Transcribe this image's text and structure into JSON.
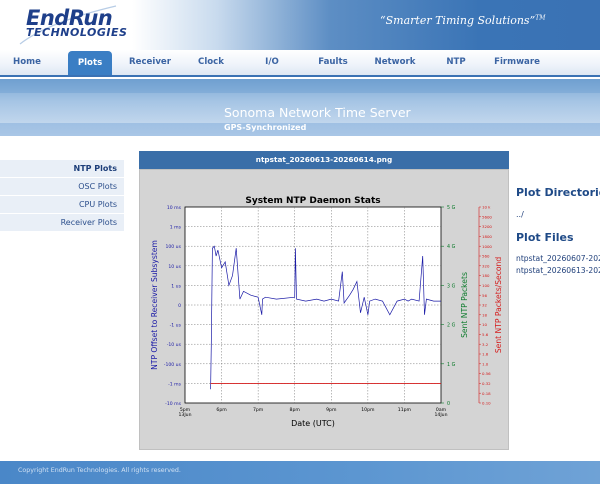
{
  "header": {
    "logo_line1": "EndRun",
    "logo_line2": "TECHNOLOGIES",
    "tagline": "“Smarter Timing Solutions”",
    "tagline_tm": "TM"
  },
  "nav": {
    "items": [
      {
        "label": "Home"
      },
      {
        "label": "Plots"
      },
      {
        "label": "Receiver"
      },
      {
        "label": "Clock"
      },
      {
        "label": "I/O"
      },
      {
        "label": "Faults"
      },
      {
        "label": "Network"
      },
      {
        "label": "NTP"
      },
      {
        "label": "Firmware"
      }
    ],
    "active": "Plots"
  },
  "banner": {
    "title": "Sonoma Network Time Server",
    "subtitle": "GPS-Synchronized"
  },
  "sidebar": {
    "items": [
      {
        "label": "NTP Plots"
      },
      {
        "label": "OSC Plots"
      },
      {
        "label": "CPU Plots"
      },
      {
        "label": "Receiver Plots"
      }
    ],
    "active": "NTP Plots"
  },
  "panel": {
    "filename": "ntpstat_20260613-20260614.png"
  },
  "right": {
    "dir_title": "Plot Directories",
    "dir_link": "../",
    "files_title": "Plot Files",
    "files": [
      {
        "name": "ntpstat_20260607-20260608.png"
      },
      {
        "name": "ntpstat_20260613-20260614.png"
      }
    ]
  },
  "footer": {
    "text": "Copyright EndRun Technologies. All rights reserved."
  },
  "colors": {
    "brand_blue": "#3a72b4",
    "offset_series": "#1a1aa6",
    "packets_series": "#0a7a2a",
    "rate_series": "#d41a1a"
  },
  "chart_data": {
    "type": "line",
    "title": "System NTP Daemon Stats",
    "xlabel": "Date (UTC)",
    "ylabel_left": "NTP Offset to Receiver Subsystem",
    "ylabel_right1": "Sent NTP Packets",
    "ylabel_right2": "Sent NTP Packets/Second",
    "x_ticks": [
      "5pm\n13Jun",
      "6pm",
      "7pm",
      "8pm",
      "9pm",
      "10pm",
      "11pm",
      "0am\n14Jun"
    ],
    "x_range_hours": [
      17,
      24
    ],
    "left_ticks": [
      "10 ms",
      "1 ms",
      "100 us",
      "10 us",
      "1 us",
      "0",
      "-1 us",
      "-10 us",
      "-100 us",
      "-1 ms",
      "-10 ms"
    ],
    "right1_ticks": [
      "5 G",
      "4 G",
      "3 G",
      "2 G",
      "1 G",
      "0"
    ],
    "right2_ticks": [
      "10 k",
      "5600",
      "3200",
      "1800",
      "1000",
      "560",
      "320",
      "180",
      "100",
      "56",
      "32",
      "18",
      "10",
      "5.6",
      "3.2",
      "1.8",
      "1.0",
      "0.56",
      "0.32",
      "0.18",
      "0.10"
    ],
    "grid": true,
    "series": [
      {
        "name": "NTP Offset",
        "axis": "left",
        "x_hours": [
          17.7,
          17.72,
          17.75,
          17.8,
          17.85,
          17.9,
          18.0,
          18.1,
          18.2,
          18.3,
          18.4,
          18.5,
          18.6,
          18.8,
          19.0,
          19.1,
          19.12,
          19.2,
          19.5,
          20.0,
          20.02,
          20.05,
          20.3,
          20.6,
          20.8,
          21.0,
          21.2,
          21.3,
          21.35,
          21.5,
          21.6,
          21.7,
          21.8,
          21.9,
          22.0,
          22.05,
          22.2,
          22.4,
          22.6,
          22.8,
          23.0,
          23.1,
          23.2,
          23.4,
          23.5,
          23.55,
          23.6,
          23.8,
          24.0
        ],
        "offset_level": [
          -4.3,
          -2.0,
          2.9,
          3.0,
          2.5,
          2.8,
          1.9,
          2.2,
          1.0,
          1.5,
          2.9,
          0.3,
          0.7,
          0.5,
          0.4,
          -0.5,
          0.3,
          0.4,
          0.3,
          0.4,
          2.9,
          0.3,
          0.2,
          0.3,
          0.2,
          0.3,
          0.2,
          1.7,
          0.1,
          0.5,
          0.8,
          1.2,
          -0.4,
          0.4,
          -0.5,
          0.2,
          0.3,
          0.2,
          -0.5,
          0.2,
          0.3,
          0.2,
          0.3,
          0.2,
          2.5,
          -0.5,
          0.3,
          0.2,
          0.2
        ]
      },
      {
        "name": "Sent NTP Packets/Second",
        "axis": "right2",
        "value": 0.32
      }
    ]
  }
}
